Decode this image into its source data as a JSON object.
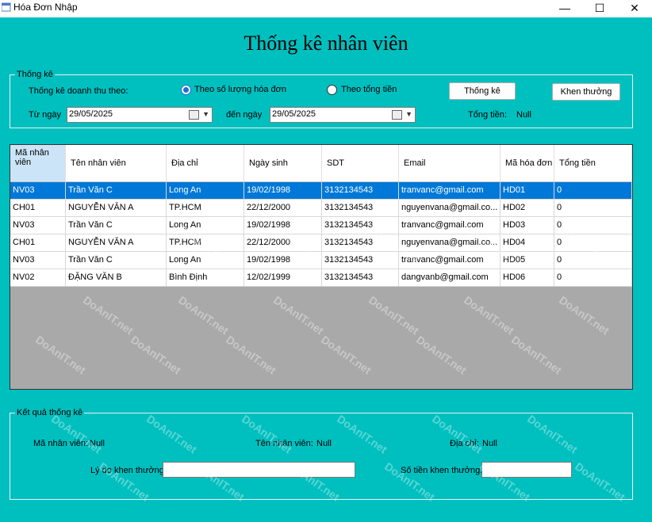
{
  "window": {
    "title": "Hóa Đơn Nhập",
    "minimize": "—",
    "maximize": "☐",
    "close": "✕"
  },
  "heading": "Thống kê nhân viên",
  "stats_group": {
    "legend": "Thống kê",
    "revenue_by_label": "Thống kê doanh thu theo:",
    "radio_invoice_count": "Theo số lượng hóa đơn",
    "radio_invoice_count_checked": true,
    "radio_total": "Theo tổng tiền",
    "radio_total_checked": false,
    "btn_statistics": "Thống kê",
    "btn_reward": "Khen thưởng",
    "from_label": "Từ ngày",
    "from_value": "29/05/2025",
    "to_label": "đến ngày",
    "to_value": "29/05/2025",
    "total_label": "Tổng tiền:",
    "total_value": "Null"
  },
  "grid": {
    "columns": [
      "Mã nhân viên",
      "Tên nhân viên",
      "Địa chỉ",
      "Ngày sinh",
      "SDT",
      "Email",
      "Mã hóa đơn",
      "Tổng tiền"
    ],
    "rows": [
      [
        "NV03",
        "Trần Văn C",
        "Long An",
        "19/02/1998",
        "3132134543",
        "tranvanc@gmail.com",
        "HD01",
        "0"
      ],
      [
        "CH01",
        "NGUYỄN VĂN A",
        "TP.HCM",
        "22/12/2000",
        "3132134543",
        "nguyenvana@gmail.co...",
        "HD02",
        "0"
      ],
      [
        "NV03",
        "Trần Văn C",
        "Long An",
        "19/02/1998",
        "3132134543",
        "tranvanc@gmail.com",
        "HD03",
        "0"
      ],
      [
        "CH01",
        "NGUYỄN VĂN A",
        "TP.HCM",
        "22/12/2000",
        "3132134543",
        "nguyenvana@gmail.co...",
        "HD04",
        "0"
      ],
      [
        "NV03",
        "Trần Văn C",
        "Long An",
        "19/02/1998",
        "3132134543",
        "tranvanc@gmail.com",
        "HD05",
        "0"
      ],
      [
        "NV02",
        "ĐẶNG VĂN B",
        "Bình Định",
        "12/02/1999",
        "3132134543",
        "dangvanb@gmail.com",
        "HD06",
        "0"
      ]
    ],
    "selected_row": 0
  },
  "result_group": {
    "legend": "Kết quả thống kê",
    "emp_id_label": "Mã nhân viên:",
    "emp_id_value": "Null",
    "emp_name_label": "Tên nhân viên:",
    "emp_name_value": "Null",
    "address_label": "Địa chỉ:",
    "address_value": "Null",
    "reason_label": "Lý do khen thưởng:",
    "reason_value": "",
    "amount_label": "Số tiền khen thưởng:",
    "amount_value": ""
  },
  "watermark": "DoAnIT.net",
  "colors": {
    "background": "#00bfbf",
    "selection": "#0078d7",
    "grid_empty": "#a9a9a9"
  }
}
